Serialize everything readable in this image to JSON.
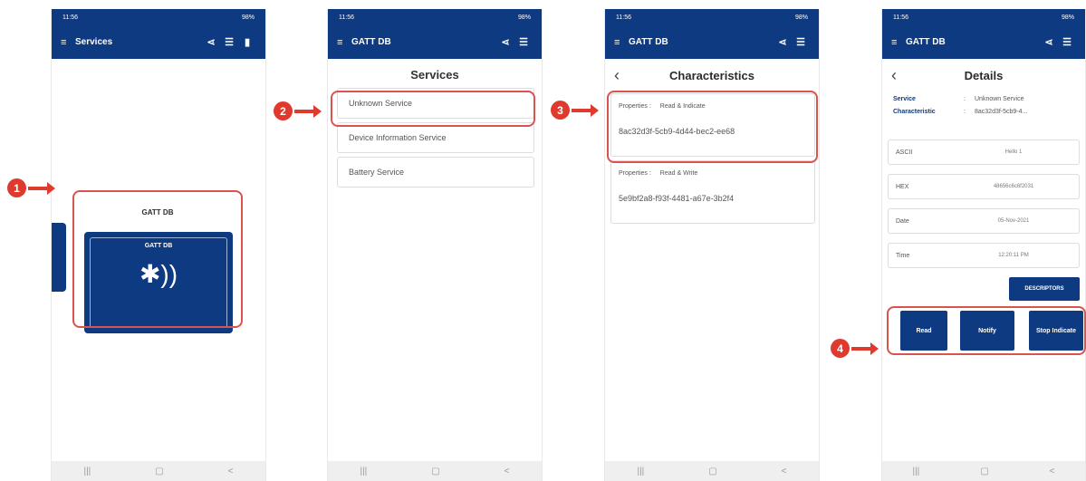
{
  "status_bar": {
    "time": "11:56",
    "right": "98%"
  },
  "panel1": {
    "app_title": "Services",
    "device_name": "GATT DB",
    "tile_name": "GATT DB"
  },
  "panel2": {
    "app_title": "GATT DB",
    "screen_title": "Services",
    "services": [
      "Unknown Service",
      "Device Information Service",
      "Battery Service"
    ]
  },
  "panel3": {
    "app_title": "GATT DB",
    "screen_title": "Characteristics",
    "characteristics": [
      {
        "props_label": "Properties :",
        "props_value": "Read & Indicate",
        "uuid": "8ac32d3f-5cb9-4d44-bec2-ee68"
      },
      {
        "props_label": "Properties :",
        "props_value": "Read & Write",
        "uuid": "5e9bf2a8-f93f-4481-a67e-3b2f4"
      }
    ]
  },
  "panel4": {
    "app_title": "GATT DB",
    "screen_title": "Details",
    "service_label": "Service",
    "service_value": "Unknown Service",
    "char_label": "Characteristic",
    "char_value": "8ac32d3f-5cb9-4...",
    "fields": [
      {
        "label": "ASCII",
        "value": "Hello 1"
      },
      {
        "label": "HEX",
        "value": "48656c6c6f2031"
      },
      {
        "label": "Date",
        "value": "05-Nov-2021"
      },
      {
        "label": "Time",
        "value": "12:20:11 PM"
      }
    ],
    "descriptors_label": "DESCRIPTORS",
    "read_label": "Read",
    "notify_label": "Notify",
    "stop_indicate_label": "Stop Indicate"
  },
  "nav": {
    "recent": "|||",
    "home": "▢",
    "back": "<"
  },
  "callouts": [
    "1",
    "2",
    "3",
    "4"
  ],
  "colors": {
    "accent": "#0d3a80",
    "highlight": "#e03a2f"
  }
}
